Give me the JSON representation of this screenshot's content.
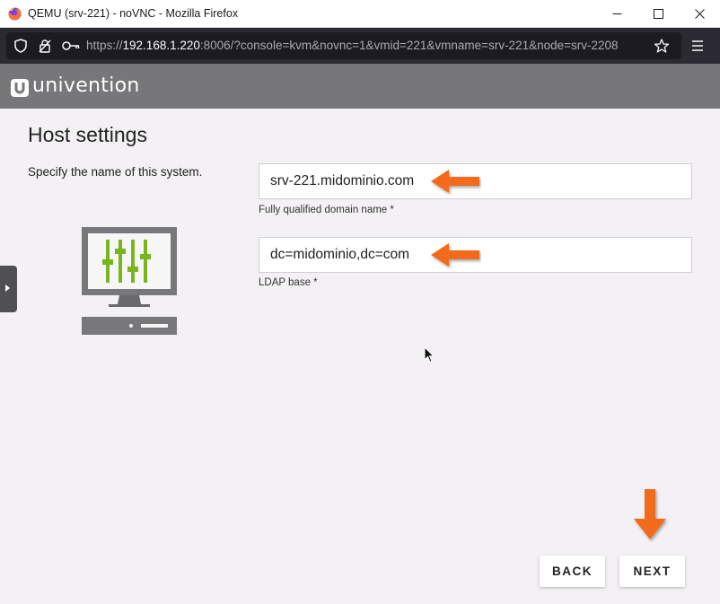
{
  "window": {
    "title": "QEMU (srv-221) - noVNC - Mozilla Firefox",
    "minimize": "—",
    "maximize": "☐",
    "close": "✕"
  },
  "browser": {
    "url_prefix": "https://",
    "url_host": "192.168.1.220",
    "url_rest": ":8006/?console=kvm&novnc=1&vmid=221&vmname=srv-221&node=srv-2208"
  },
  "brand": {
    "name": "univention"
  },
  "page": {
    "title": "Host settings",
    "description": "Specify the name of this system."
  },
  "form": {
    "fqdn": {
      "value": "srv-221.midominio.com",
      "label": "Fully qualified domain name *"
    },
    "ldap_base": {
      "value": "dc=midominio,dc=com",
      "label": "LDAP base *"
    }
  },
  "buttons": {
    "back": "BACK",
    "next": "NEXT"
  },
  "colors": {
    "accent_arrow": "#f26a1b",
    "header_bg": "#777779",
    "illustration_green": "#7ab51d",
    "illustration_gray": "#78787a"
  }
}
